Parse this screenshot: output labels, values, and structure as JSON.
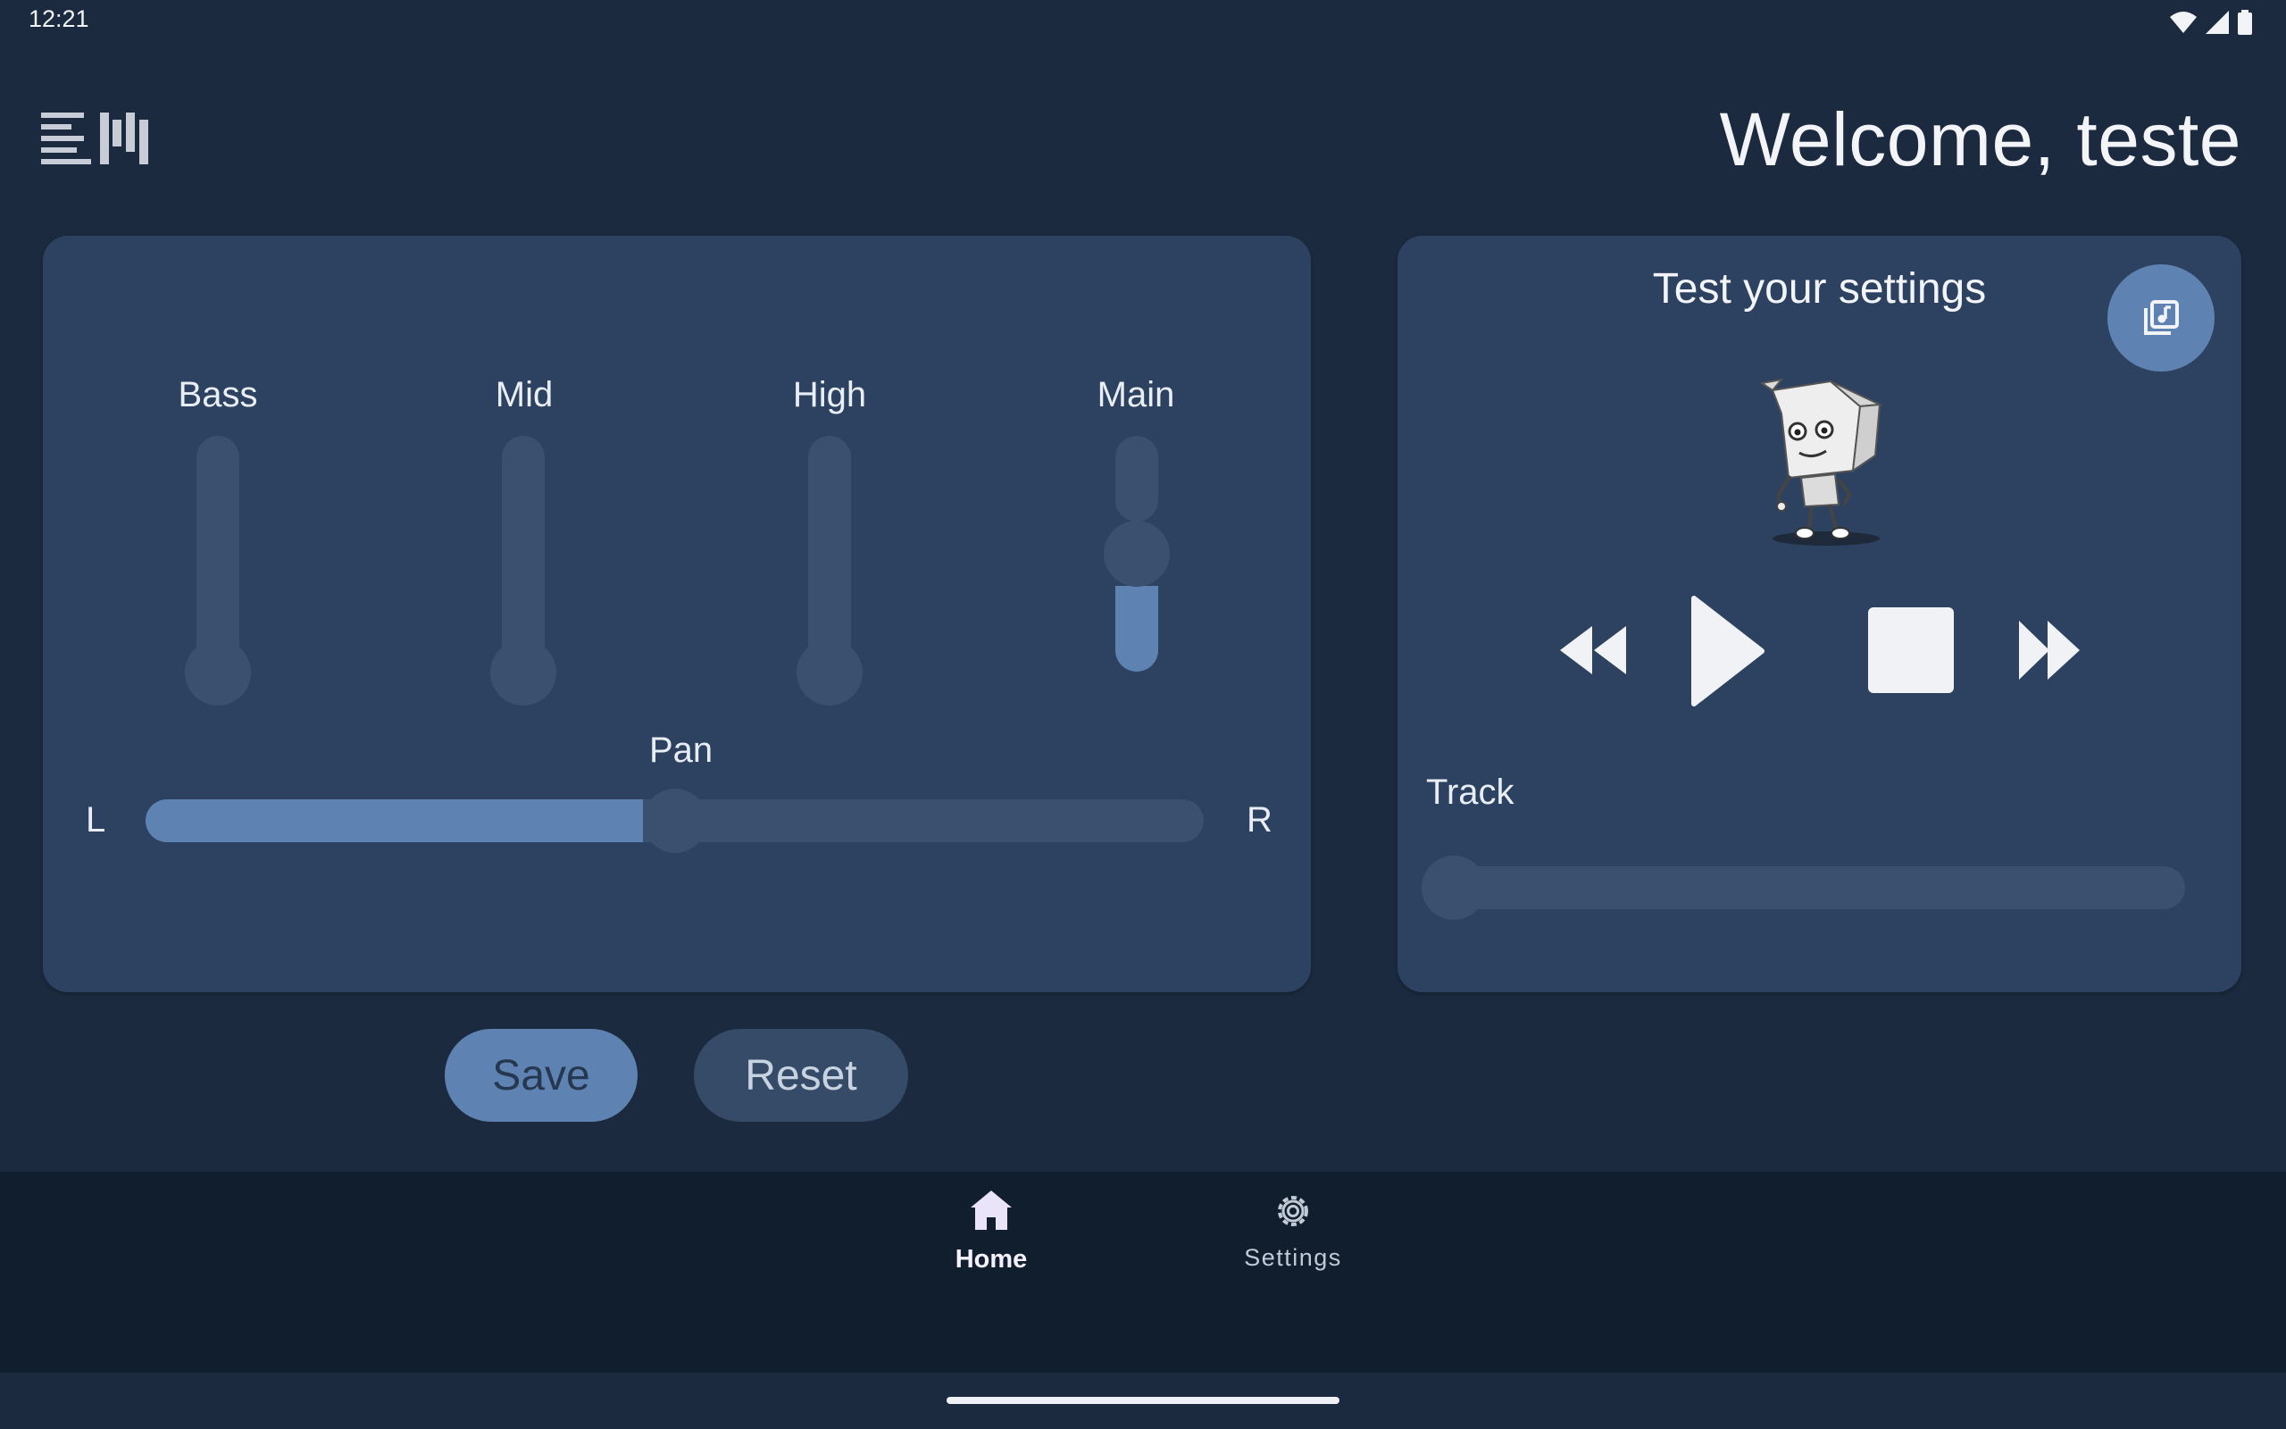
{
  "status_bar": {
    "time": "12:21",
    "icons": [
      "wifi-icon",
      "signal-icon",
      "battery-icon"
    ]
  },
  "header": {
    "logo_icon": "app-logo",
    "welcome_prefix": "Welcome, ",
    "username": "teste"
  },
  "equalizer": {
    "bands": [
      {
        "label": "Bass",
        "level": 0
      },
      {
        "label": "Mid",
        "level": 0
      },
      {
        "label": "High",
        "level": 0
      },
      {
        "label": "Main",
        "level": 0.5
      }
    ],
    "pan": {
      "label": "Pan",
      "left_label": "L",
      "right_label": "R",
      "value": 0.5
    }
  },
  "actions": {
    "save_label": "Save",
    "reset_label": "Reset"
  },
  "player": {
    "title": "Test your settings",
    "library_icon": "music-library-icon",
    "controls": [
      "rewind-icon",
      "play-icon",
      "stop-icon",
      "fast-forward-icon"
    ],
    "track_label": "Track",
    "track_position": 0
  },
  "nav": {
    "items": [
      {
        "label": "Home",
        "icon": "home-icon",
        "active": true
      },
      {
        "label": "Settings",
        "icon": "settings-icon",
        "active": false
      }
    ]
  },
  "colors": {
    "background": "#1b2a3e",
    "card": "#2d4260",
    "accent": "#5e83b2",
    "track": "#3a506e",
    "nav_background": "#111e2d"
  }
}
